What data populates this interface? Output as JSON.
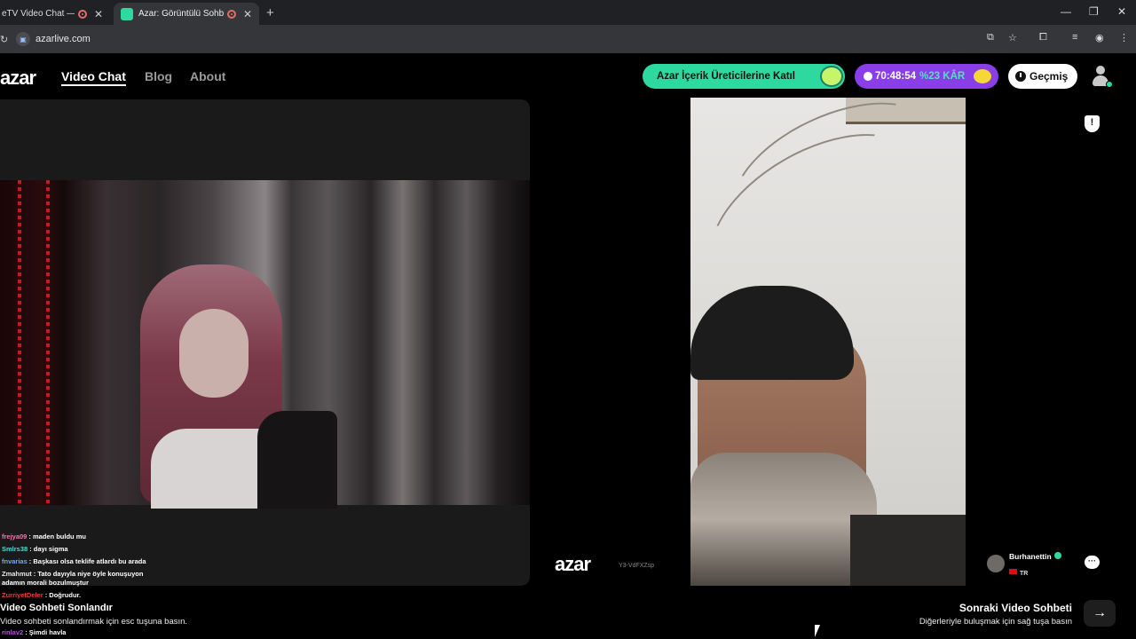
{
  "browser": {
    "tabs": [
      {
        "title": "eTV Video Chat — Ome",
        "active": false
      },
      {
        "title": "Azar: Görüntülü Sohbet & V",
        "active": true
      }
    ],
    "new_tab_icon": "+",
    "window_controls": {
      "minimize": "—",
      "maximize": "❐",
      "close": "✕"
    },
    "url": "azarlive.com"
  },
  "header": {
    "logo": "azar",
    "nav": [
      "Video Chat",
      "Blog",
      "About"
    ],
    "creators_button": "Azar İçerik Üreticilerine Katıl",
    "timer": {
      "time": "70:48:54",
      "discount": "%23 KÂR"
    },
    "history_button": "Geçmiş"
  },
  "chat_messages": [
    {
      "user": "frejya09",
      "text": "maden buldu mu",
      "color": "#f07aa8"
    },
    {
      "user": "Smlrs38",
      "text": "dayı sigma",
      "color": "#59d9d2"
    },
    {
      "user": "fnvarias",
      "text": "Başkası olsa teklife atlardı bu arada",
      "color": "#7aa8f0"
    },
    {
      "user": "Zmahmut",
      "text": "Tato dayıyla niye öyle konuşuyon",
      "color": "#e8e8e8"
    },
    {
      "user": "",
      "text": "adamın morali bozulmuştur",
      "color": "#e8e8e8"
    },
    {
      "user": "ZurriyetDeler",
      "text": "Doğrudur.",
      "color": "#e0433f"
    },
    {
      "user": "rinlav2",
      "text": "Şimdi havla",
      "color": "#b455d6"
    }
  ],
  "local": {
    "title": "Video Sohbeti Sonlandır",
    "hint": "Video sohbeti sonlandırmak için esc tuşuna basın."
  },
  "watermark": {
    "logo": "azar",
    "code": "Y3-VdFXZsp"
  },
  "remote": {
    "name": "Burhanettin",
    "country": "TR"
  },
  "next": {
    "title": "Sonraki Video Sohbeti",
    "hint": "Diğerleriyle buluşmak için sağ tuşa basın",
    "arrow": "→"
  },
  "colors": {
    "accent_green": "#2ed9a0",
    "accent_purple": "#8a3ee8"
  }
}
